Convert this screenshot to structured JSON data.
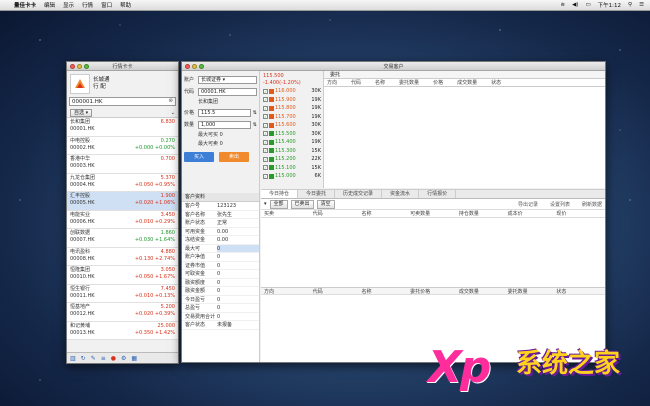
{
  "menubar": {
    "apple": "",
    "app_name": "量佳卡卡",
    "items": [
      "编辑",
      "显示",
      "行情",
      "窗口",
      "帮助"
    ],
    "clock": "下午1:12"
  },
  "quote_window": {
    "title": "行情卡卡",
    "user": {
      "name": "长城通",
      "sub": "行 配"
    },
    "search_value": "000001.HK",
    "tab_label": "自选",
    "items": [
      {
        "name": "长和集团",
        "code": "00001.HK",
        "price": "6.830",
        "change": "",
        "dir": "up"
      },
      {
        "name": "中电控股",
        "code": "00002.HK",
        "price": "0.270",
        "change": "+0.000",
        "pct": "+0.00%",
        "dir": "dn"
      },
      {
        "name": "香港中华",
        "code": "00003.HK",
        "price": "0.700",
        "change": "",
        "dir": "up"
      },
      {
        "name": "九龙仓集团",
        "code": "00004.HK",
        "price": "5.370",
        "change": "+0.050",
        "pct": "+0.95%",
        "dir": "up"
      },
      {
        "name": "汇丰控股",
        "code": "00005.HK",
        "price": "1.900",
        "change": "+0.020",
        "pct": "+1.06%",
        "dir": "up",
        "selected": true
      },
      {
        "name": "电能实业",
        "code": "00006.HK",
        "price": "3.450",
        "change": "+0.010",
        "pct": "+0.29%",
        "dir": "up"
      },
      {
        "name": "创联数据",
        "code": "00007.HK",
        "price": "1.860",
        "change": "+0.030",
        "pct": "+1.64%",
        "dir": "dn"
      },
      {
        "name": "电讯盈科",
        "code": "00008.HK",
        "price": "4.880",
        "change": "+0.130",
        "pct": "+2.74%",
        "dir": "up"
      },
      {
        "name": "恒隆集团",
        "code": "00010.HK",
        "price": "3.050",
        "change": "+0.050",
        "pct": "+1.67%",
        "dir": "up"
      },
      {
        "name": "恒生银行",
        "code": "00011.HK",
        "price": "7.450",
        "change": "+0.010",
        "pct": "+0.13%",
        "dir": "up"
      },
      {
        "name": "恒基地产",
        "code": "00012.HK",
        "price": "5.200",
        "change": "+0.020",
        "pct": "+0.39%",
        "dir": "up"
      },
      {
        "name": "和记黄埔",
        "code": "00013.HK",
        "price": "25.000",
        "change": "+0.350",
        "pct": "+1.42%",
        "dir": "up"
      },
      {
        "name": "希慎兴业",
        "code": "00014.HK",
        "price": "24.600",
        "change": "+0.100",
        "pct": "+0.41%",
        "dir": "up"
      }
    ]
  },
  "trade_window": {
    "title": "交易客户",
    "order": {
      "account_label": "账户",
      "account": "长城证券",
      "code_label": "代码",
      "code": "00001.HK",
      "name": "长和集团",
      "price_label": "价格",
      "price": "115.5",
      "qty_label": "数量",
      "qty": "1,000",
      "max_buy": "最大可买 0",
      "max_sell": "最大可卖 0",
      "buy": "买入",
      "sell": "卖出"
    },
    "depth": {
      "header": "115.500  -1.400(-1.20%)",
      "rows": [
        {
          "price": "116.000",
          "vol": "30K",
          "color": "#e05a1a"
        },
        {
          "price": "115.900",
          "vol": "19K",
          "color": "#e05a1a"
        },
        {
          "price": "115.800",
          "vol": "19K",
          "color": "#e05a1a"
        },
        {
          "price": "115.700",
          "vol": "19K",
          "color": "#e05a1a"
        },
        {
          "price": "115.600",
          "vol": "30K",
          "color": "#e05a1a"
        },
        {
          "price": "115.500",
          "vol": "30K",
          "color": "#2a9a2a"
        },
        {
          "price": "115.400",
          "vol": "19K",
          "color": "#2a9a2a"
        },
        {
          "price": "115.300",
          "vol": "15K",
          "color": "#2a9a2a"
        },
        {
          "price": "115.200",
          "vol": "22K",
          "color": "#2a9a2a"
        },
        {
          "price": "115.100",
          "vol": "15K",
          "color": "#2a9a2a"
        },
        {
          "price": "115.000",
          "vol": "6K",
          "color": "#2a9a2a"
        }
      ]
    },
    "orders_tab": "委托",
    "orders_headers": [
      "方向",
      "代码",
      "名称",
      "委托数量",
      "价格",
      "成交数量",
      "状态"
    ],
    "tabs": [
      "今日持仓",
      "今日委托",
      "历史成交记录",
      "资金流水",
      "行情报价"
    ],
    "account": {
      "header": "客户资料",
      "rows": [
        {
          "k": "客户号",
          "v": "123123"
        },
        {
          "k": "客户名称",
          "v": "张先生"
        },
        {
          "k": "账户状态",
          "v": "正常"
        },
        {
          "k": "可用资金",
          "v": "0.00"
        },
        {
          "k": "冻结资金",
          "v": "0.00"
        },
        {
          "k": "最大可",
          "v": "0",
          "hl": true
        },
        {
          "k": "账户净值",
          "v": "0"
        },
        {
          "k": "证券市值",
          "v": "0"
        },
        {
          "k": "可取资金",
          "v": "0"
        },
        {
          "k": "融资额度",
          "v": "0"
        },
        {
          "k": "融资金额",
          "v": "0"
        },
        {
          "k": "今日盈亏",
          "v": "0"
        },
        {
          "k": "总盈亏",
          "v": "0"
        },
        {
          "k": "交易费用合计",
          "v": "0"
        },
        {
          "k": "客户状态",
          "v": "未报备"
        }
      ]
    },
    "positions": {
      "btn_all": "全部",
      "btn_filter": "已卖出",
      "btn_clear": "清空",
      "right_links": [
        "导出记录",
        "设置列表",
        "刷新数据"
      ],
      "headers": [
        "买卖",
        "代码",
        "名称",
        "可卖数量",
        "持仓数量",
        "成本价",
        "现价"
      ],
      "headers2": [
        "方向",
        "代码",
        "名称",
        "委托价格",
        "成交数量",
        "委托数量",
        "状态"
      ]
    }
  },
  "watermark": {
    "xp": "Xp",
    "text": "系统之家"
  }
}
